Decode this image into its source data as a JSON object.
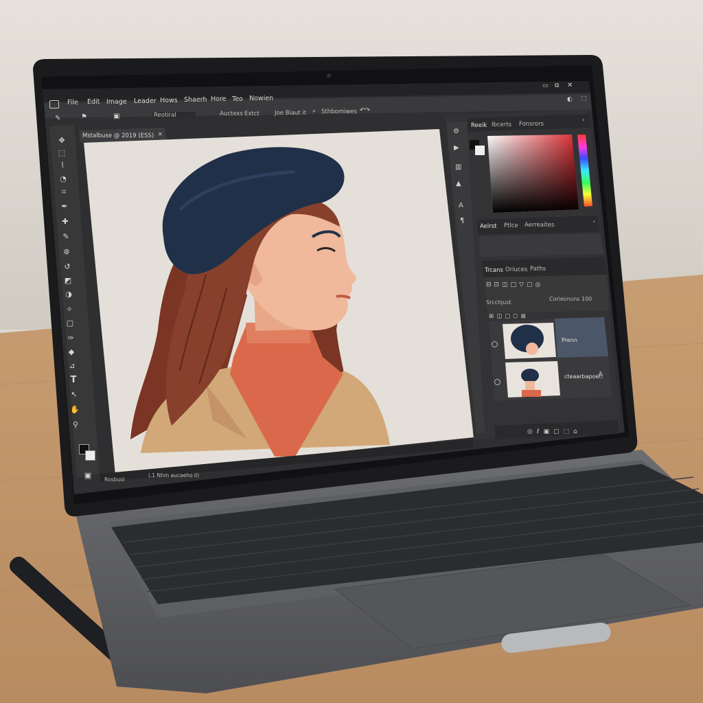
{
  "menu": {
    "items": [
      "File",
      "Edit",
      "Image",
      "Leader",
      "Hows",
      "Shaerh",
      "Hore",
      "Teo",
      "Nowien"
    ]
  },
  "options_bar": {
    "preset": "Reotiral",
    "item1": "Auctexs",
    "item2": "Extct",
    "item3": "Joe Biaut it",
    "search": "Sthbomiwes"
  },
  "document_tab": {
    "title": "Mstalbuse @ 2019 (ESS)"
  },
  "status_bar": {
    "left": "Rosbuol",
    "info": "(.1 Nhm aucaeho il)"
  },
  "color_panel": {
    "tabs": [
      "Reeik",
      "Ibcerts",
      "Fonsrors"
    ]
  },
  "adjust_panel": {
    "tabs": [
      "Aelrst",
      "Ptlce",
      "Aerreaites"
    ]
  },
  "layers_panel": {
    "tabs": [
      "Trcans",
      "Oriuces",
      "Paths"
    ],
    "blend": "Srcchjust",
    "opacity": "Coriesnuns 100",
    "layers": [
      {
        "name": "Prenn"
      },
      {
        "name": "cteaarbapoet!"
      }
    ]
  },
  "icons": {
    "window_controls": [
      "minimize-icon",
      "restore-icon",
      "close-icon"
    ],
    "tools": [
      "move-icon",
      "marquee-icon",
      "lasso-icon",
      "quick-select-icon",
      "crop-icon",
      "eyedropper-icon",
      "healing-icon",
      "brush-icon",
      "clone-stamp-icon",
      "history-brush-icon",
      "eraser-icon",
      "gradient-icon",
      "blur-icon",
      "dodge-icon",
      "pen-icon",
      "type-icon",
      "path-select-icon",
      "shape-icon",
      "hand-icon",
      "zoom-icon"
    ]
  },
  "colors": {
    "ui_dark": "#2e2e2e",
    "ui_panel": "#383838",
    "canvas_bg": "#e4e0d9",
    "beret": "#213049",
    "hair": "#7a3524",
    "skin": "#f0b99b",
    "sweater": "#d9694a",
    "coat": "#d2a878",
    "selected_layer": "#4b5668"
  }
}
